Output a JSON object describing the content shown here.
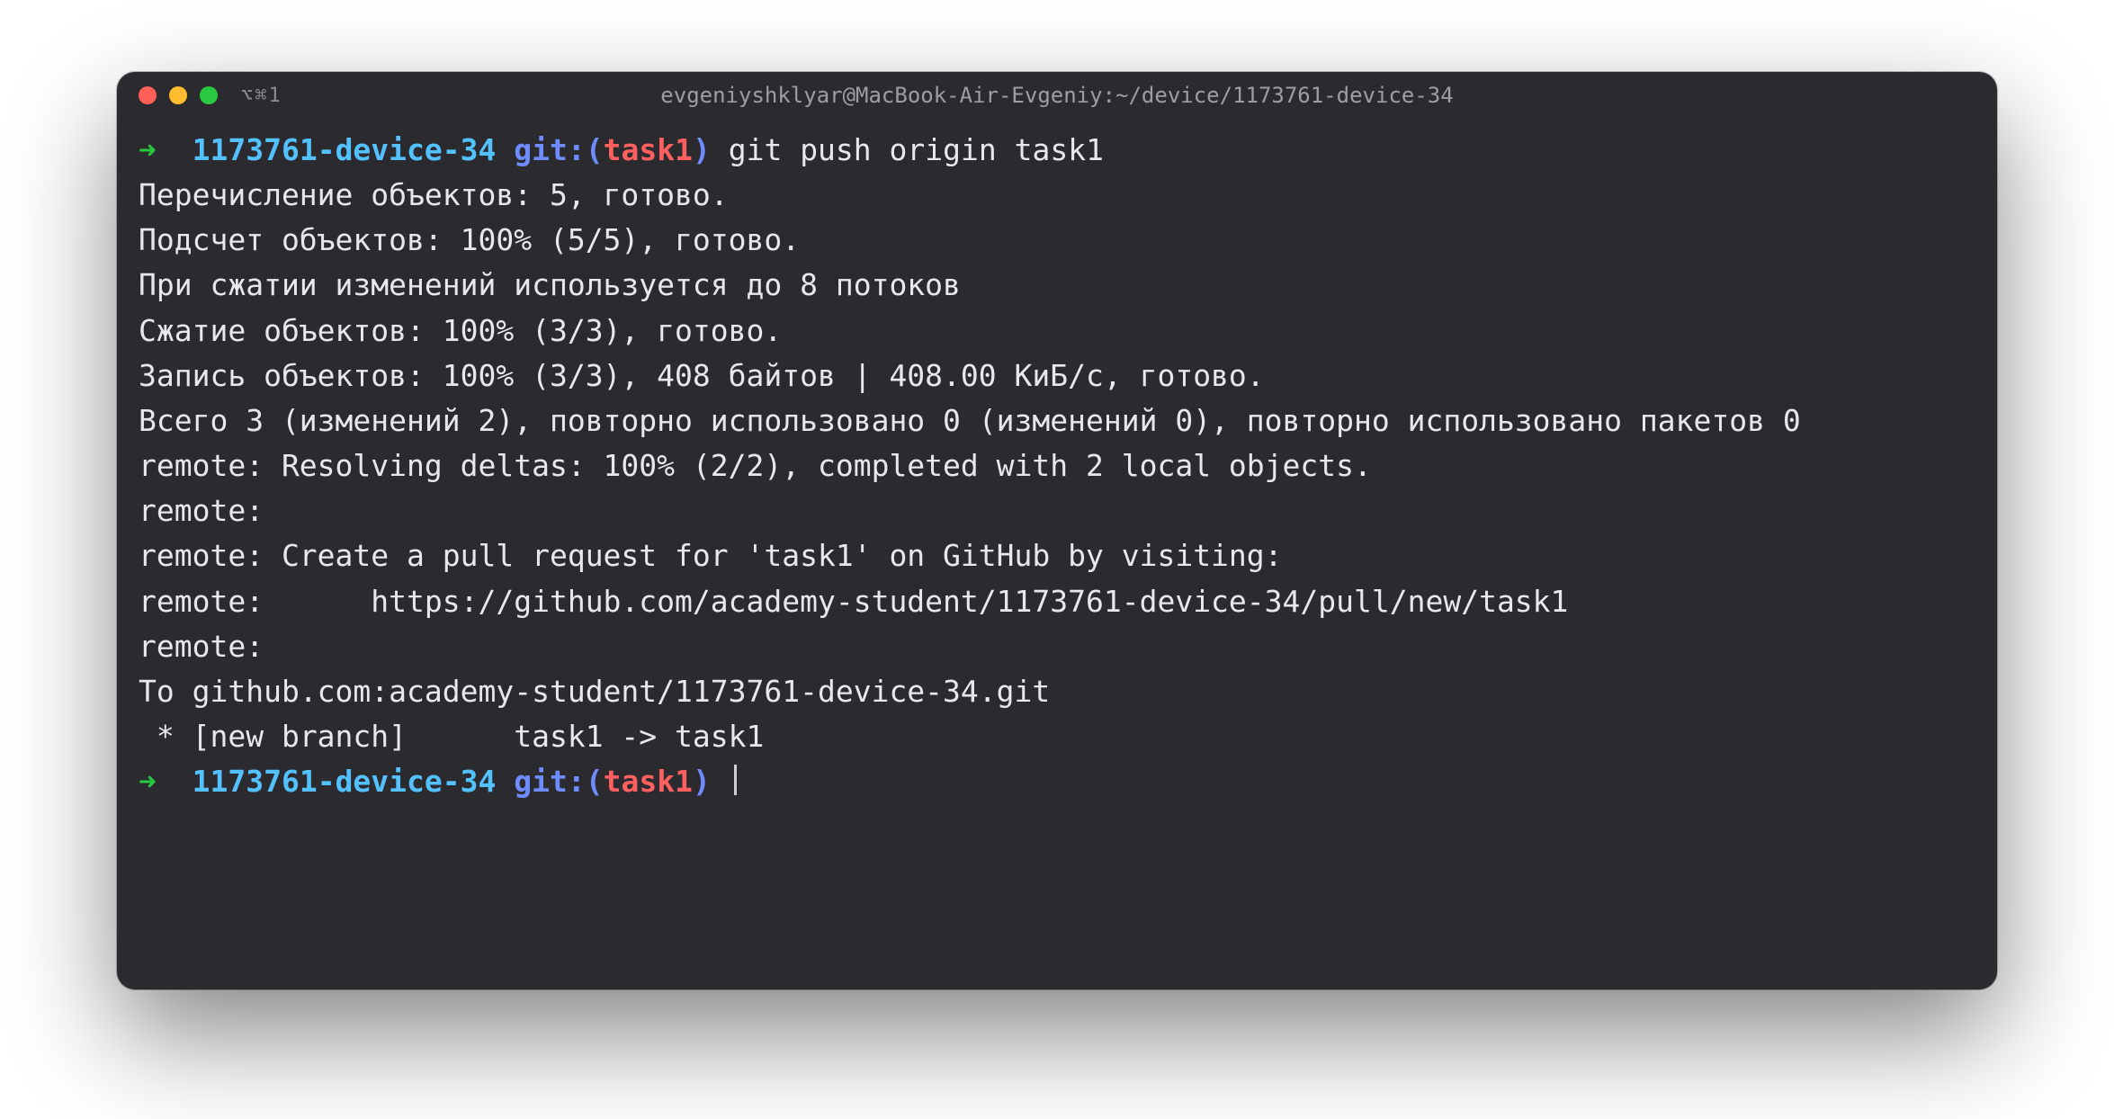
{
  "window": {
    "tab_indicator": "⌥⌘1",
    "title": "evgeniyshklyar@MacBook-Air-Evgeniy:~/device/1173761-device-34"
  },
  "prompt1": {
    "arrow": "➜",
    "cwd": "1173761-device-34",
    "git_label": "git:",
    "paren_open": "(",
    "branch": "task1",
    "paren_close": ")",
    "command": "git push origin task1"
  },
  "output": {
    "l1": "Перечисление объектов: 5, готово.",
    "l2": "Подсчет объектов: 100% (5/5), готово.",
    "l3": "При сжатии изменений используется до 8 потоков",
    "l4": "Сжатие объектов: 100% (3/3), готово.",
    "l5": "Запись объектов: 100% (3/3), 408 байтов | 408.00 КиБ/с, готово.",
    "l6": "Всего 3 (изменений 2), повторно использовано 0 (изменений 0), повторно использовано пакетов 0",
    "l7": "remote: Resolving deltas: 100% (2/2), completed with 2 local objects.",
    "l8": "remote:",
    "l9": "remote: Create a pull request for 'task1' on GitHub by visiting:",
    "l10": "remote:      https://github.com/academy-student/1173761-device-34/pull/new/task1",
    "l11": "remote:",
    "l12": "To github.com:academy-student/1173761-device-34.git",
    "l13": " * [new branch]      task1 -> task1"
  },
  "prompt2": {
    "arrow": "➜",
    "cwd": "1173761-device-34",
    "git_label": "git:",
    "paren_open": "(",
    "branch": "task1",
    "paren_close": ")"
  }
}
